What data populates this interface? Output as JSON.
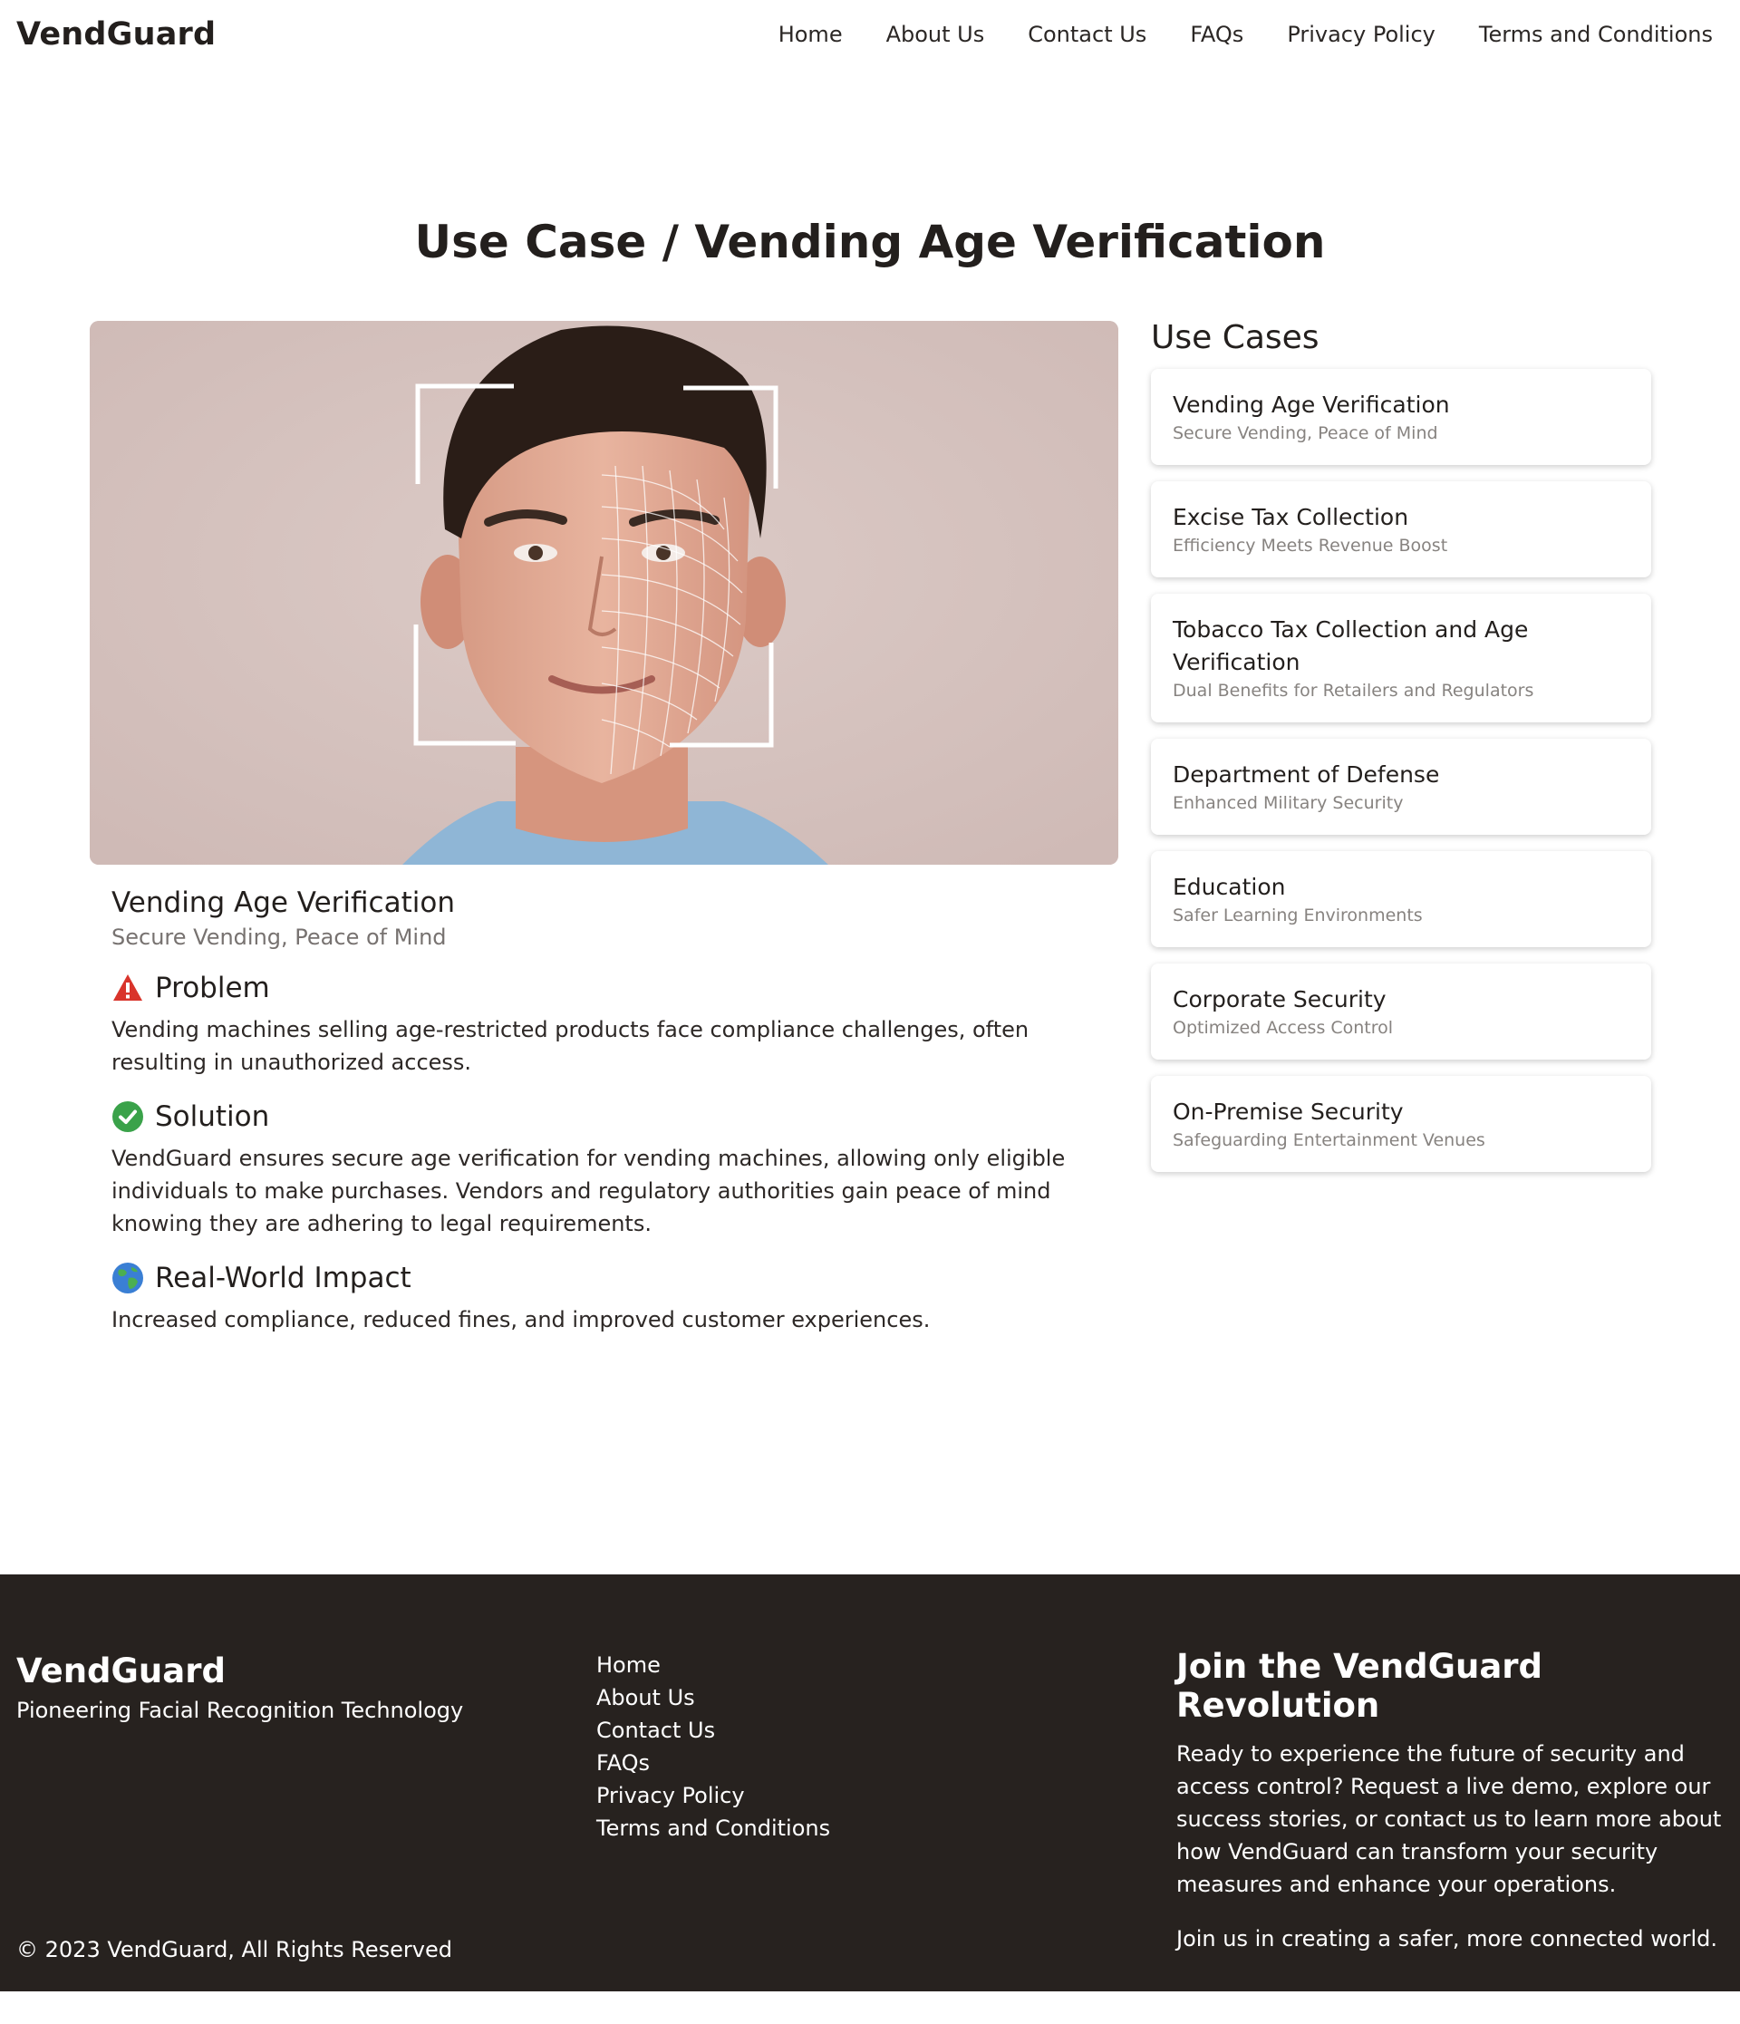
{
  "header": {
    "brand": "VendGuard",
    "nav": [
      "Home",
      "About Us",
      "Contact Us",
      "FAQs",
      "Privacy Policy",
      "Terms and Conditions"
    ]
  },
  "page_title": "Use Case / Vending Age Verification",
  "hero": {
    "alt": "face-scan-portrait"
  },
  "article": {
    "title": "Vending Age Verification",
    "subtitle": "Secure Vending, Peace of Mind",
    "sections": [
      {
        "icon": "warning-icon",
        "heading": "Problem",
        "body": "Vending machines selling age-restricted products face compliance challenges, often resulting in unauthorized access."
      },
      {
        "icon": "check-circle-icon",
        "heading": "Solution",
        "body": "VendGuard ensures secure age verification for vending machines, allowing only eligible individuals to make purchases. Vendors and regulatory authorities gain peace of mind knowing they are adhering to legal requirements."
      },
      {
        "icon": "globe-icon",
        "heading": "Real-World Impact",
        "body": "Increased compliance, reduced fines, and improved customer experiences."
      }
    ]
  },
  "sidebar": {
    "title": "Use Cases",
    "cards": [
      {
        "title": "Vending Age Verification",
        "subtitle": "Secure Vending, Peace of Mind"
      },
      {
        "title": "Excise Tax Collection",
        "subtitle": "Efficiency Meets Revenue Boost"
      },
      {
        "title": "Tobacco Tax Collection and Age Verification",
        "subtitle": "Dual Benefits for Retailers and Regulators"
      },
      {
        "title": "Department of Defense",
        "subtitle": "Enhanced Military Security"
      },
      {
        "title": "Education",
        "subtitle": "Safer Learning Environments"
      },
      {
        "title": "Corporate Security",
        "subtitle": "Optimized Access Control"
      },
      {
        "title": "On-Premise Security",
        "subtitle": "Safeguarding Entertainment Venues"
      }
    ]
  },
  "footer": {
    "brand": "VendGuard",
    "tagline": "Pioneering Facial Recognition Technology",
    "links": [
      "Home",
      "About Us",
      "Contact Us",
      "FAQs",
      "Privacy Policy",
      "Terms and Conditions"
    ],
    "join_title": "Join the VendGuard Revolution",
    "join_text": "Ready to experience the future of security and access control? Request a live demo, explore our success stories, or contact us to learn more about how VendGuard can transform your security measures and enhance your operations.",
    "join_text2": "Join us in creating a safer, more connected world.",
    "copyright": "© 2023 VendGuard, All Rights Reserved"
  },
  "colors": {
    "text": "#231f1d",
    "muted": "#777270",
    "footer_bg": "#27221f",
    "warning": "#d9342b",
    "success": "#3aa24a"
  }
}
